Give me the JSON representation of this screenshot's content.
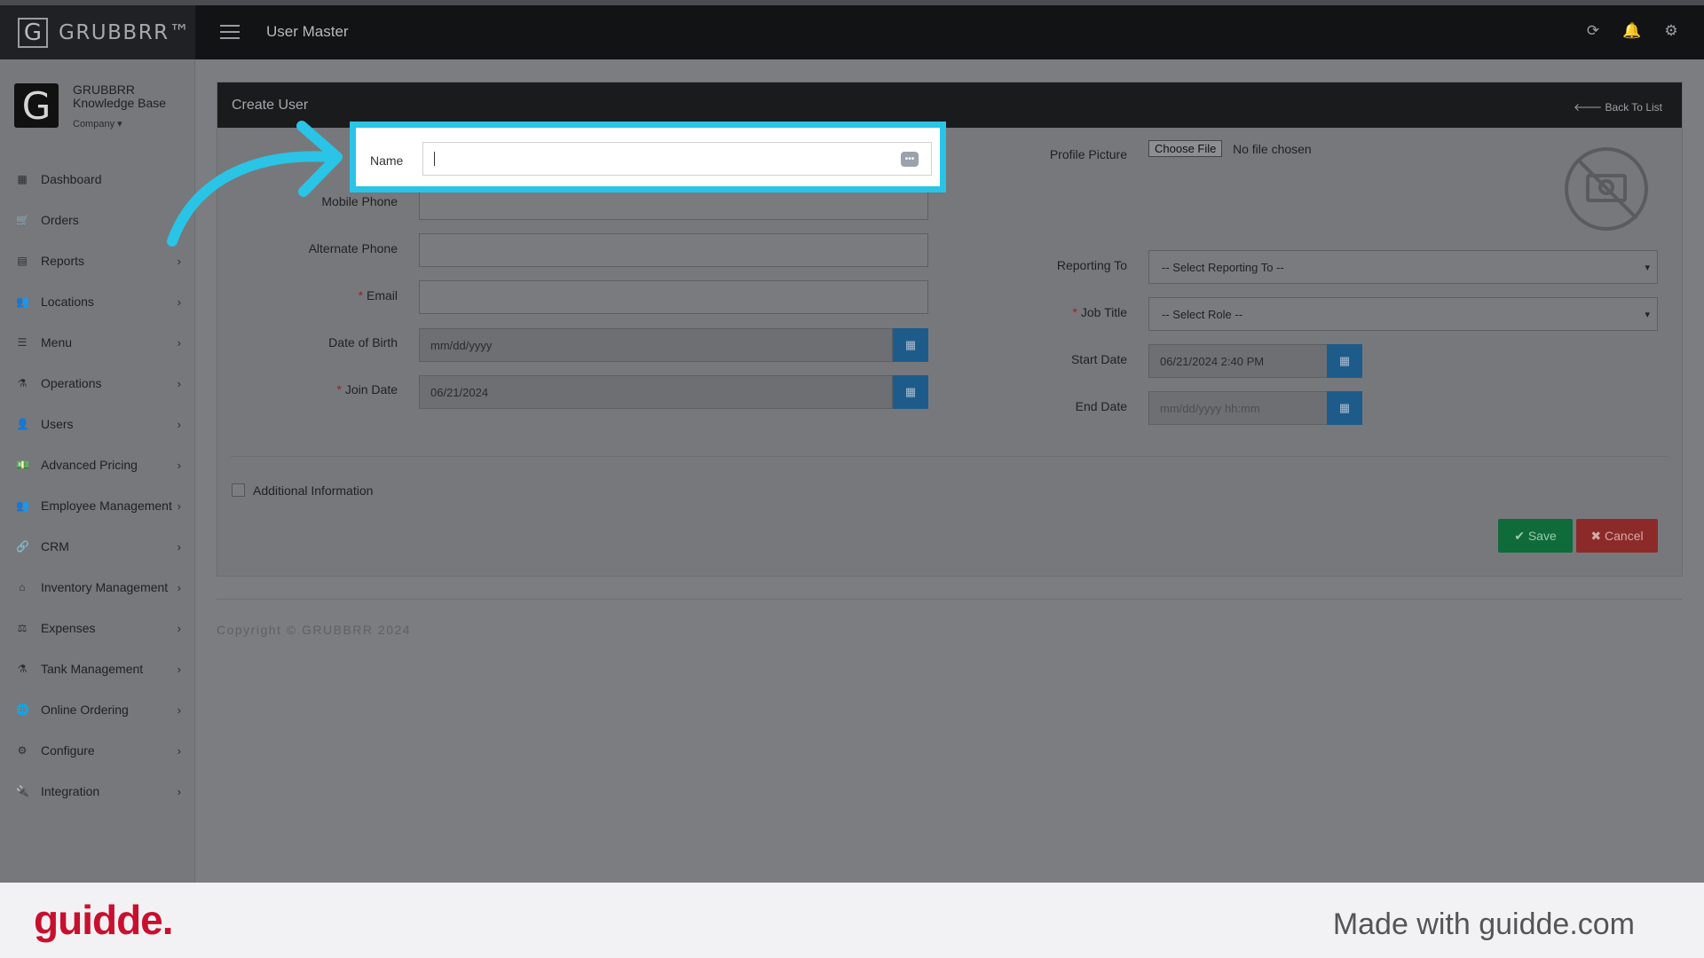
{
  "app": {
    "brand": "GRUBBRR™",
    "brand_letter": "G",
    "page_title": "User Master"
  },
  "company": {
    "logo_letter": "G",
    "name_line1": "GRUBBRR",
    "name_line2": "Knowledge Base",
    "selector": "Company ▾"
  },
  "sidebar": {
    "items": [
      {
        "label": "Dashboard",
        "icon": "dashboard-icon",
        "glyph": "▦",
        "chevron": false
      },
      {
        "label": "Orders",
        "icon": "cart-icon",
        "glyph": "🛒",
        "chevron": false
      },
      {
        "label": "Reports",
        "icon": "report-icon",
        "glyph": "▤",
        "chevron": true
      },
      {
        "label": "Locations",
        "icon": "locations-icon",
        "glyph": "👥",
        "chevron": true
      },
      {
        "label": "Menu",
        "icon": "menu-icon",
        "glyph": "☰",
        "chevron": true
      },
      {
        "label": "Operations",
        "icon": "flask-icon",
        "glyph": "⚗",
        "chevron": true
      },
      {
        "label": "Users",
        "icon": "user-add-icon",
        "glyph": "👤",
        "chevron": true
      },
      {
        "label": "Advanced Pricing",
        "icon": "money-icon",
        "glyph": "💵",
        "chevron": true
      },
      {
        "label": "Employee Management",
        "icon": "employees-icon",
        "glyph": "👥",
        "chevron": true
      },
      {
        "label": "CRM",
        "icon": "link-icon",
        "glyph": "🔗",
        "chevron": true
      },
      {
        "label": "Inventory Management",
        "icon": "sitemap-icon",
        "glyph": "⌂",
        "chevron": true
      },
      {
        "label": "Expenses",
        "icon": "balance-icon",
        "glyph": "⚖",
        "chevron": true
      },
      {
        "label": "Tank Management",
        "icon": "flask-icon",
        "glyph": "⚗",
        "chevron": true
      },
      {
        "label": "Online Ordering",
        "icon": "globe-icon",
        "glyph": "🌐",
        "chevron": true
      },
      {
        "label": "Configure",
        "icon": "gear-icon",
        "glyph": "⚙",
        "chevron": true
      },
      {
        "label": "Integration",
        "icon": "plug-icon",
        "glyph": "🔌",
        "chevron": true
      }
    ]
  },
  "panel": {
    "title": "Create User",
    "back_link": "Back To List"
  },
  "form": {
    "name_label": "Name",
    "name_value": "",
    "mobile_label": "Mobile Phone",
    "alternate_label": "Alternate Phone",
    "email_label": "Email",
    "dob_label": "Date of Birth",
    "dob_placeholder": "mm/dd/yyyy",
    "join_label": "Join Date",
    "join_value": "06/21/2024",
    "profile_label": "Profile Picture",
    "file_button": "Choose File",
    "file_status": "No file chosen",
    "reporting_label": "Reporting To",
    "reporting_value": "-- Select Reporting To --",
    "job_label": "Job Title",
    "job_value": "-- Select Role --",
    "start_label": "Start Date",
    "start_value": "06/21/2024 2:40 PM",
    "end_label": "End Date",
    "end_placeholder": "mm/dd/yyyy hh:mm",
    "additional_label": "Additional Information",
    "required_mark": "*"
  },
  "actions": {
    "save": "Save",
    "cancel": "Cancel"
  },
  "copyright": "Copyright © GRUBBRR 2024",
  "footer": {
    "logo": "guidde.",
    "tagline": "Made with guidde.com"
  },
  "colors": {
    "highlight": "#29c4e6",
    "save": "#0f6b3a",
    "cancel": "#8c2a2a",
    "calendar": "#1d5c8a",
    "guidde_red": "#c8102e"
  }
}
